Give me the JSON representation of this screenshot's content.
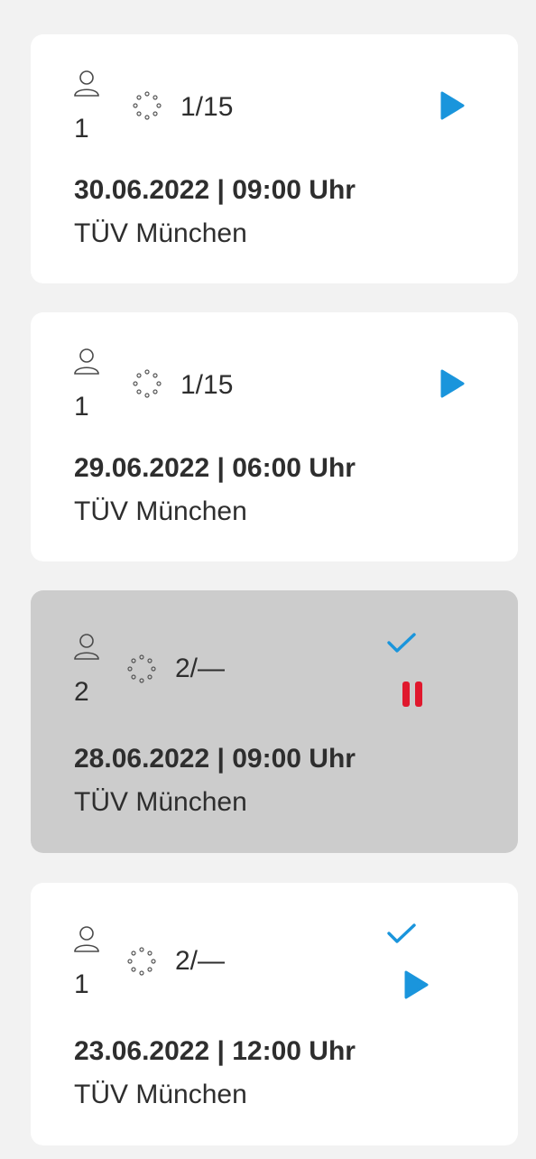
{
  "colors": {
    "background": "#f2f2f2",
    "card": "#ffffff",
    "card_selected": "#cccccc",
    "play_accent": "#1a95dc",
    "check_accent": "#1a95dc",
    "pause_accent": "#e0182d",
    "text": "#2e2e2e"
  },
  "icons": {
    "person": "person-icon",
    "spinner": "spinner-icon",
    "play": "play-icon",
    "check": "check-icon",
    "pause": "pause-icon"
  },
  "appointments": [
    {
      "persons": "1",
      "progress": "1/15",
      "datetime": "30.06.2022 | 09:00 Uhr",
      "location": "TÜV München",
      "selected": false,
      "status_actions": [
        "play"
      ]
    },
    {
      "persons": "1",
      "progress": "1/15",
      "datetime": "29.06.2022 | 06:00 Uhr",
      "location": "TÜV München",
      "selected": false,
      "status_actions": [
        "play"
      ]
    },
    {
      "persons": "2",
      "progress": "2/—",
      "datetime": "28.06.2022 | 09:00 Uhr",
      "location": "TÜV München",
      "selected": true,
      "status_actions": [
        "check",
        "pause"
      ]
    },
    {
      "persons": "1",
      "progress": "2/—",
      "datetime": "23.06.2022 | 12:00 Uhr",
      "location": "TÜV München",
      "selected": false,
      "status_actions": [
        "check",
        "play"
      ]
    }
  ]
}
